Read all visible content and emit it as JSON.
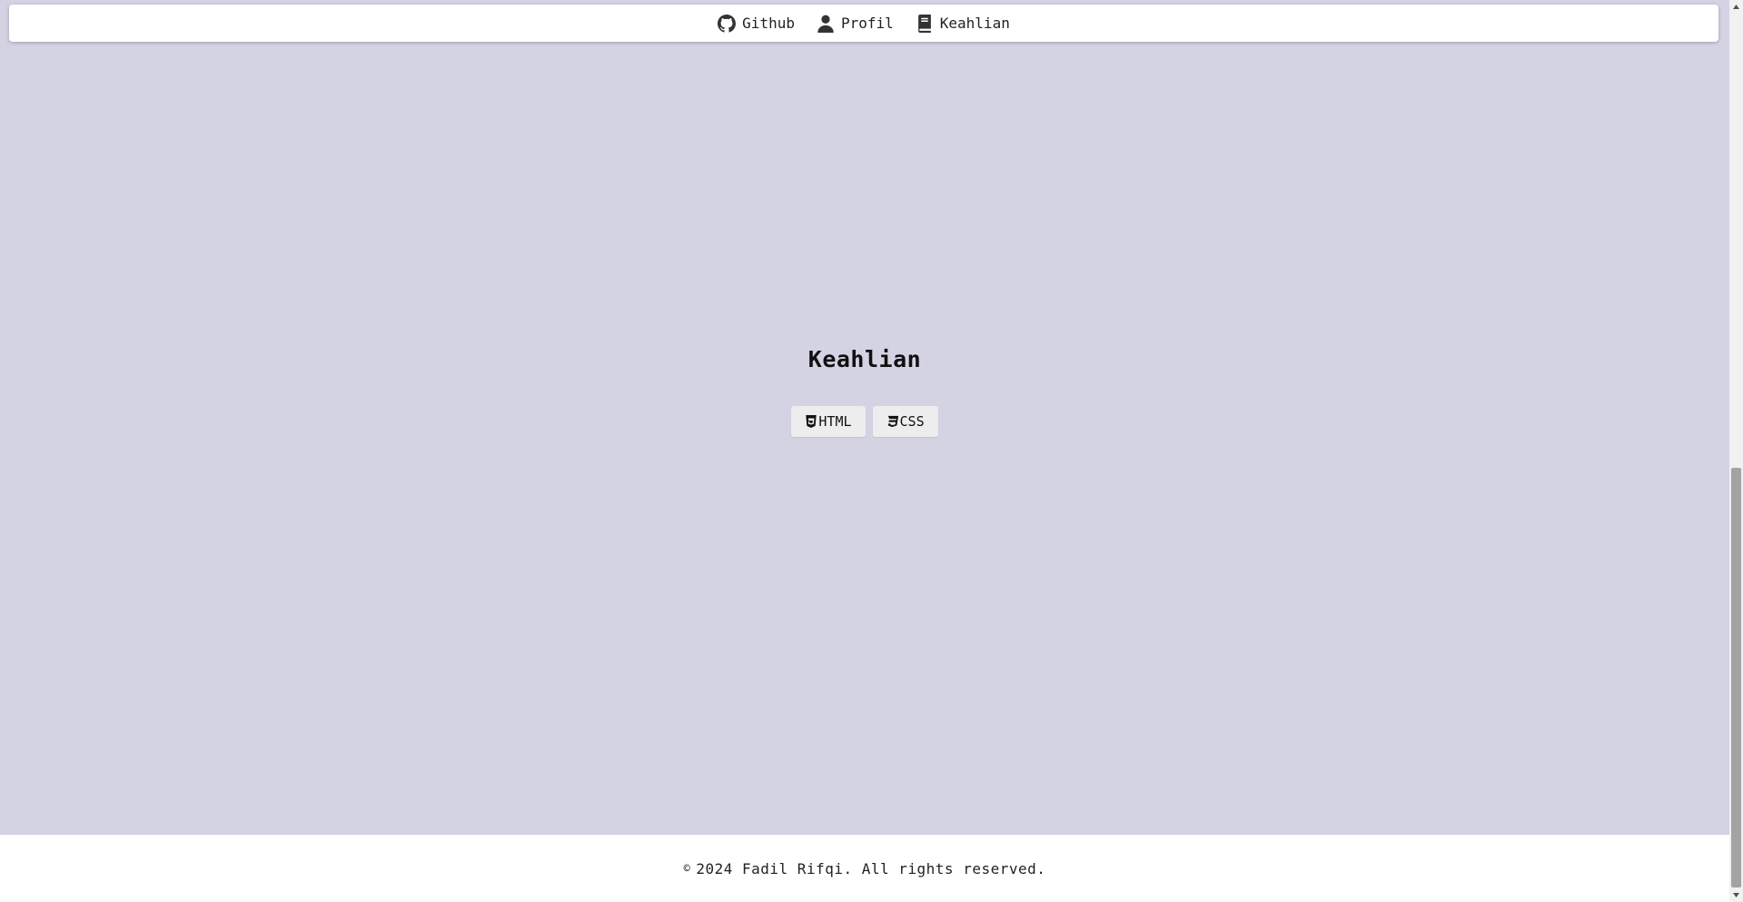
{
  "nav": {
    "items": [
      {
        "label": "Github",
        "icon": "github-icon"
      },
      {
        "label": "Profil",
        "icon": "user-icon"
      },
      {
        "label": "Keahlian",
        "icon": "book-icon"
      }
    ]
  },
  "main": {
    "title": "Keahlian",
    "skills": [
      {
        "label": "HTML",
        "icon": "html5-icon"
      },
      {
        "label": "CSS",
        "icon": "css3-icon"
      }
    ]
  },
  "footer": {
    "copyright_symbol": "©",
    "text": "2024 Fadil Rifqi. All rights reserved."
  },
  "colors": {
    "background": "#d4d3e3",
    "navbar": "#ffffff",
    "footer": "#ffffff",
    "badge": "#ededed"
  }
}
